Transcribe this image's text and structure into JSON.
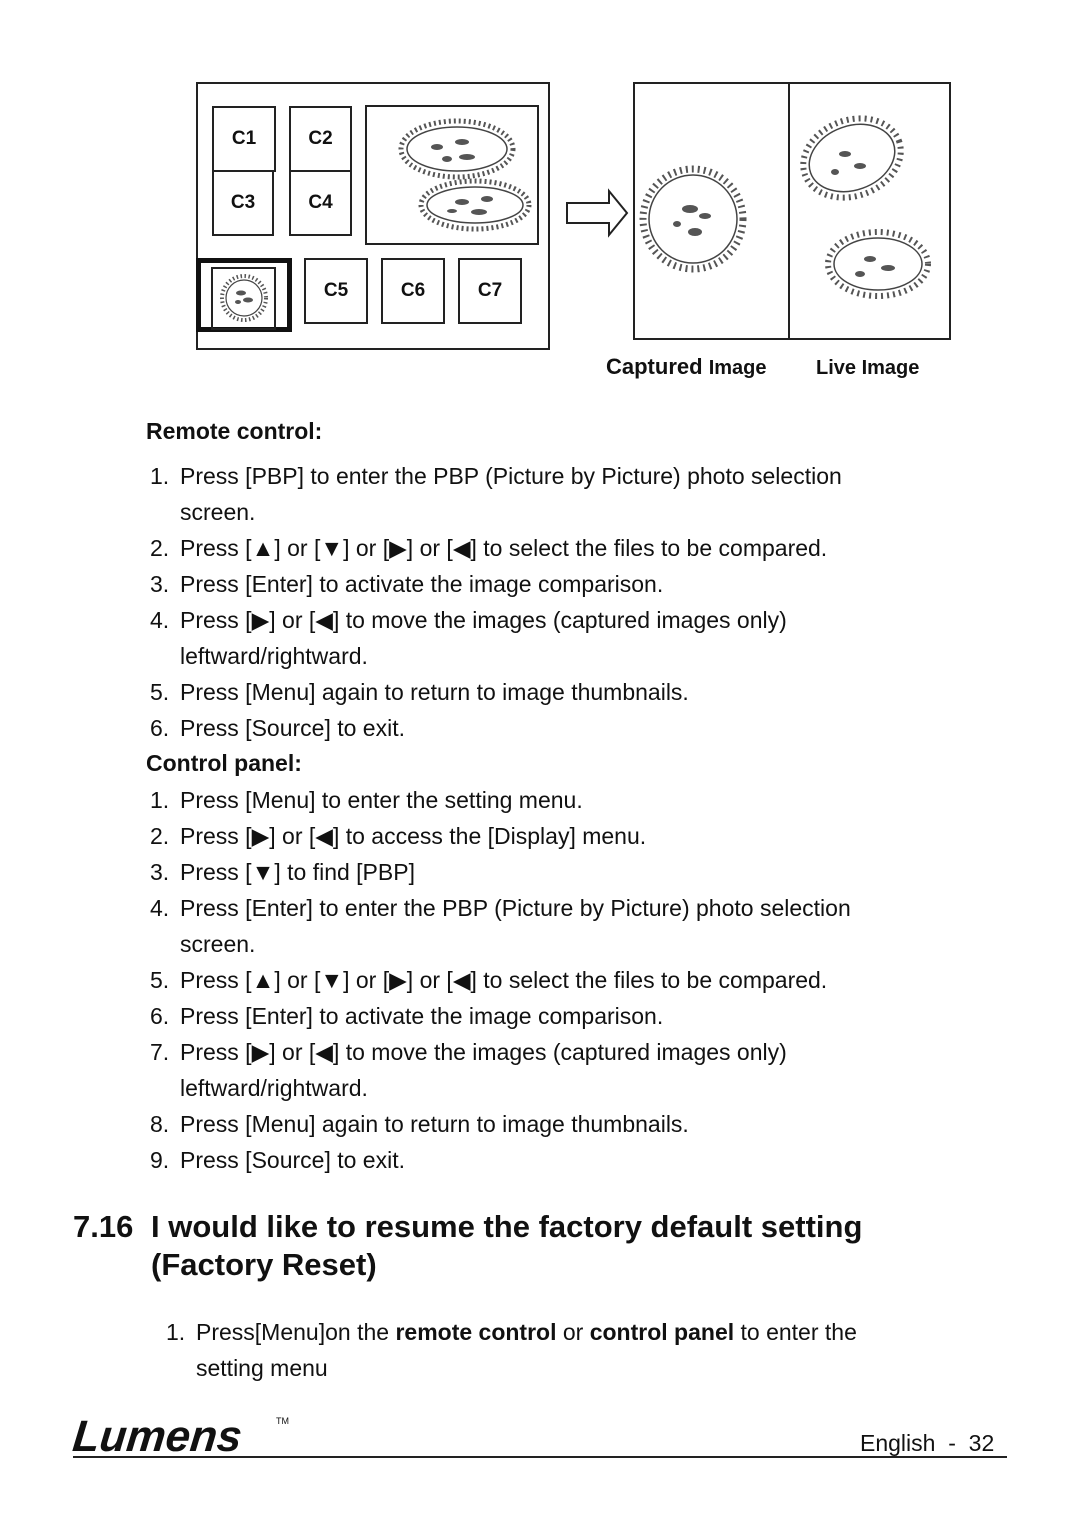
{
  "figure": {
    "thumbnails": [
      "C1",
      "C2",
      "C3",
      "C4",
      "C5",
      "C6",
      "C7"
    ],
    "captions": {
      "captured_bold": "Captured",
      "captured_rest": "Image",
      "live": "Live Image"
    }
  },
  "remote_control": {
    "heading": "Remote control:",
    "steps": [
      {
        "num": "1.",
        "text": "Press [PBP] to enter the PBP (Picture by Picture) photo selection",
        "cont": "screen."
      },
      {
        "num": "2.",
        "text": "Press [▲] or [▼] or [▶] or [◀] to select the files to be compared."
      },
      {
        "num": "3.",
        "text": "Press [Enter] to activate the image comparison."
      },
      {
        "num": "4.",
        "text": "Press [▶] or [◀] to move the images (captured images only)",
        "cont": "leftward/rightward."
      },
      {
        "num": "5.",
        "text": "Press [Menu] again to return to image thumbnails."
      },
      {
        "num": "6.",
        "text": "Press [Source] to exit."
      }
    ]
  },
  "control_panel": {
    "heading": "Control panel:",
    "steps": [
      {
        "num": "1.",
        "text": "Press [Menu] to enter the setting menu."
      },
      {
        "num": "2.",
        "text": "Press [▶] or [◀] to access the [Display] menu."
      },
      {
        "num": "3.",
        "text": "Press [▼] to find [PBP]"
      },
      {
        "num": "4.",
        "text": "Press [Enter] to enter the PBP (Picture by Picture) photo selection",
        "cont": "screen."
      },
      {
        "num": "5.",
        "text": "Press [▲] or [▼] or [▶] or [◀] to select the files to be compared."
      },
      {
        "num": "6.",
        "text": "Press [Enter] to activate the image comparison."
      },
      {
        "num": "7.",
        "text": "Press [▶] or [◀] to move the images (captured images only)",
        "cont": "leftward/rightward."
      },
      {
        "num": "8.",
        "text": "Press [Menu] again to return to image thumbnails."
      },
      {
        "num": "9.",
        "text": "Press [Source] to exit."
      }
    ]
  },
  "section_716": {
    "number": "7.16",
    "title_line1": "I would like to resume the factory default setting",
    "title_line2": "(Factory Reset)",
    "step1": {
      "num": "1.",
      "part1": "Press[Menu]on the ",
      "bold1": "remote control",
      "part2": " or ",
      "bold2": "control panel",
      "part3": " to enter the",
      "cont": "setting menu"
    }
  },
  "footer": {
    "logo": "Lumens",
    "trademark": "TM",
    "page_label": "English  -  32"
  }
}
